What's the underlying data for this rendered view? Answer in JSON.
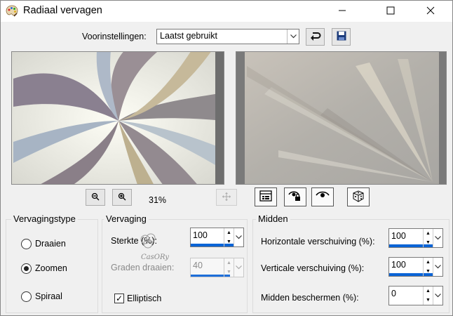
{
  "window": {
    "title": "Radiaal vervagen"
  },
  "presets": {
    "label": "Voorinstellingen:",
    "value": "Laatst gebruikt"
  },
  "zoom": {
    "percent": "31%"
  },
  "groups": {
    "type": {
      "legend": "Vervagingstype",
      "options": [
        "Draaien",
        "Zoomen",
        "Spiraal"
      ],
      "selected": "Zoomen"
    },
    "blur": {
      "legend": "Vervaging",
      "strength_label": "Sterkte (%):",
      "strength_value": "100",
      "rotate_label": "Graden draaien:",
      "rotate_value": "40",
      "elliptic_label": "Elliptisch",
      "elliptic_checked": true
    },
    "center": {
      "legend": "Midden",
      "h_label": "Horizontale verschuiving (%):",
      "h_value": "100",
      "v_label": "Verticale verschuiving (%):",
      "v_value": "100",
      "protect_label": "Midden beschermen (%):",
      "protect_value": "0"
    }
  },
  "colors": {
    "accent": "#0a64d6"
  }
}
